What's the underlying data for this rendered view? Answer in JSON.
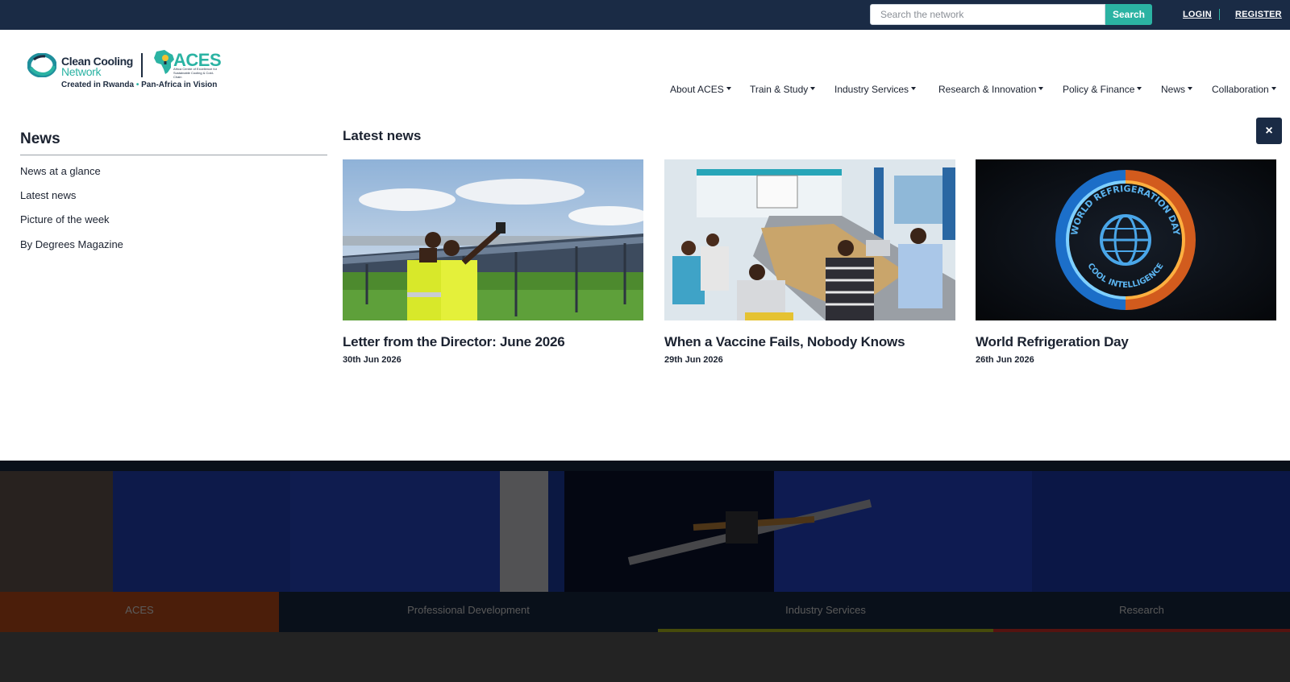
{
  "topbar": {
    "search_placeholder": "Search the network",
    "search_button": "Search",
    "login": "LOGIN",
    "register": "REGISTER"
  },
  "logo": {
    "ccn_line1": "Clean Cooling",
    "ccn_line2": "Network",
    "aces": "ACES",
    "aces_sub": "Africa Centre of Excellence for Sustainable Cooling & Cold-Chain",
    "tagline_left": "Created in Rwanda",
    "tagline_sep": "•",
    "tagline_right": "Pan-Africa in Vision"
  },
  "nav": {
    "items": [
      {
        "label": "About ACES"
      },
      {
        "label": "Train & Study"
      },
      {
        "label": "Industry Services"
      },
      {
        "label": "Research & Innovation"
      },
      {
        "label": "Policy & Finance"
      },
      {
        "label": "News"
      },
      {
        "label": "Collaboration"
      }
    ]
  },
  "mega": {
    "side_title": "News",
    "links": [
      "News at a glance",
      "Latest news",
      "Picture of the week",
      "By Degrees Magazine"
    ],
    "latest_title": "Latest news",
    "close": "×",
    "cards": [
      {
        "title": "Letter from the Director: June 2026",
        "date": "30th Jun 2026"
      },
      {
        "title": "When a Vaccine Fails, Nobody Knows",
        "date": "29th Jun 2026"
      },
      {
        "title": "World Refrigeration Day",
        "date": "26th Jun 2026",
        "image_text_top": "WORLD REFRIGERATION DAY",
        "image_text_bottom": "COOL INTELLIGENCE"
      }
    ]
  },
  "tabs": [
    {
      "label": "ACES",
      "color": "#c4501b"
    },
    {
      "label": "Professional Development",
      "color": "#1a2b45"
    },
    {
      "label": "Industry Services",
      "color": "#b9c61f"
    },
    {
      "label": "Research",
      "color": "#e0322b"
    }
  ],
  "colors": {
    "navy": "#1a2b45",
    "teal": "#2bb3a3"
  }
}
